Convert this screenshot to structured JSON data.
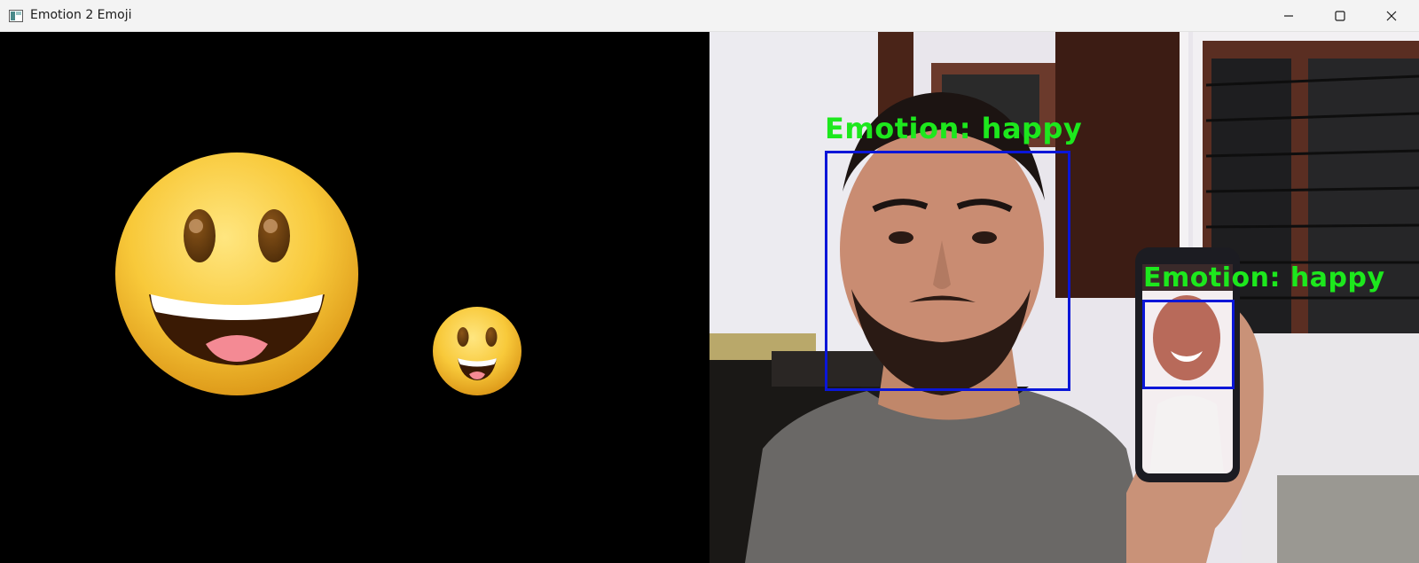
{
  "window": {
    "title": "Emotion 2 Emoji",
    "icons": {
      "app": "app-window-icon",
      "minimize": "minimize-icon",
      "maximize": "maximize-icon",
      "close": "close-icon"
    }
  },
  "emoji_panel": {
    "emojis": [
      {
        "name": "grinning-face-emoji",
        "emotion": "happy"
      },
      {
        "name": "grinning-face-emoji",
        "emotion": "happy"
      }
    ]
  },
  "camera_panel": {
    "detections": [
      {
        "label": "Emotion: happy",
        "target": "person-face"
      },
      {
        "label": "Emotion: happy",
        "target": "phone-screen-face"
      }
    ],
    "colors": {
      "label": "#1de81d",
      "box": "#0a16d8"
    }
  }
}
